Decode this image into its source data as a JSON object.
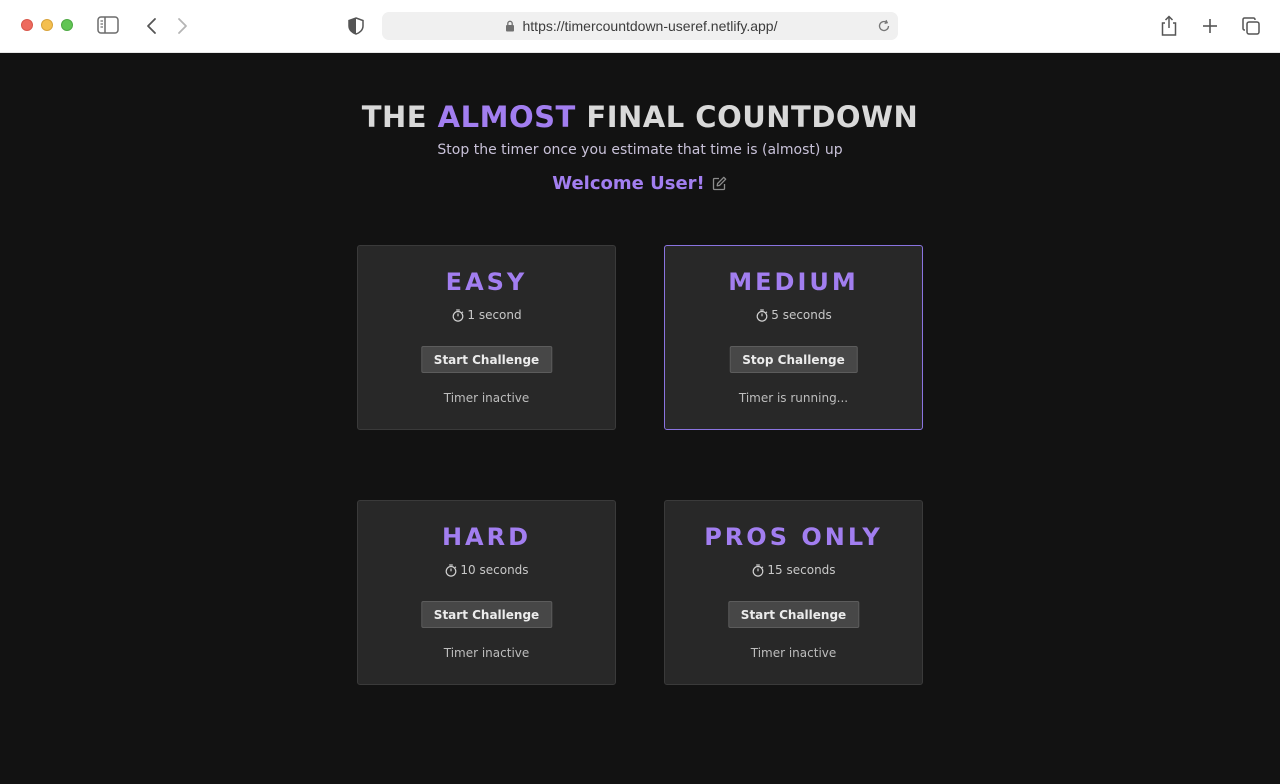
{
  "browser": {
    "url": "https://timercountdown-useref.netlify.app/"
  },
  "header": {
    "title_pre": "THE",
    "title_accent": "ALMOST",
    "title_post": "FINAL COUNTDOWN",
    "subtitle": "Stop the timer once you estimate that time is (almost) up",
    "welcome": "Welcome User!"
  },
  "challenges": [
    {
      "title": "EASY",
      "time": "1 second",
      "button": "Start Challenge",
      "status": "Timer inactive"
    },
    {
      "title": "MEDIUM",
      "time": "5 seconds",
      "button": "Stop Challenge",
      "status": "Timer is running..."
    },
    {
      "title": "HARD",
      "time": "10 seconds",
      "button": "Start Challenge",
      "status": "Timer inactive"
    },
    {
      "title": "PROS ONLY",
      "time": "15 seconds",
      "button": "Start Challenge",
      "status": "Timer inactive"
    }
  ],
  "icons": {
    "edit": "edit-icon",
    "stopwatch": "stopwatch-icon",
    "lock": "lock-icon"
  },
  "colors": {
    "accent": "#a27ef0",
    "background": "#121212",
    "card": "#282828",
    "active_border": "#8a74e0"
  }
}
